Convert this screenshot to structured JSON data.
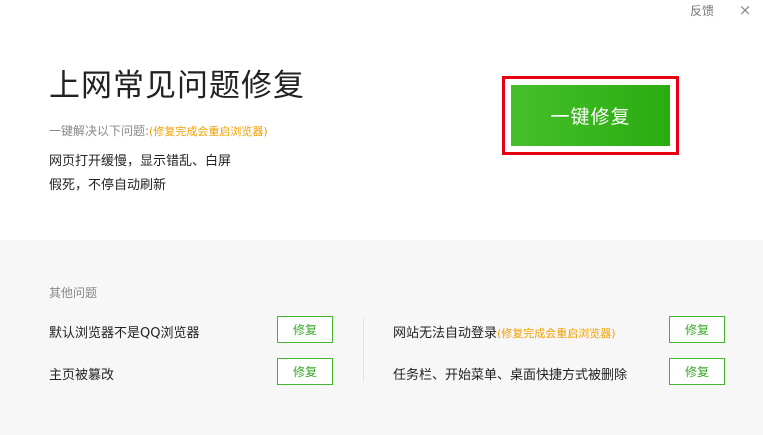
{
  "titlebar": {
    "feedback_label": "反馈",
    "close_glyph": "×"
  },
  "main": {
    "title": "上网常见问题修复",
    "intro_label": "一键解决以下问题:",
    "intro_note": "(修复完成会重启浏览器)",
    "symptoms": [
      "网页打开缓慢，显示错乱、白屏",
      "假死，不停自动刷新"
    ],
    "fix_all_label": "一键修复"
  },
  "other": {
    "section_title": "其他问题",
    "repair_label": "修复",
    "issues": [
      {
        "label": "默认浏览器不是QQ浏览器",
        "note": ""
      },
      {
        "label": "主页被篡改",
        "note": ""
      },
      {
        "label": "网站无法自动登录",
        "note": "(修复完成会重启浏览器)"
      },
      {
        "label": "任务栏、开始菜单、桌面快捷方式被删除",
        "note": ""
      }
    ]
  },
  "colors": {
    "accent_green": "#2aac10",
    "highlight_red": "#e60012",
    "note_orange": "#f0a000"
  }
}
